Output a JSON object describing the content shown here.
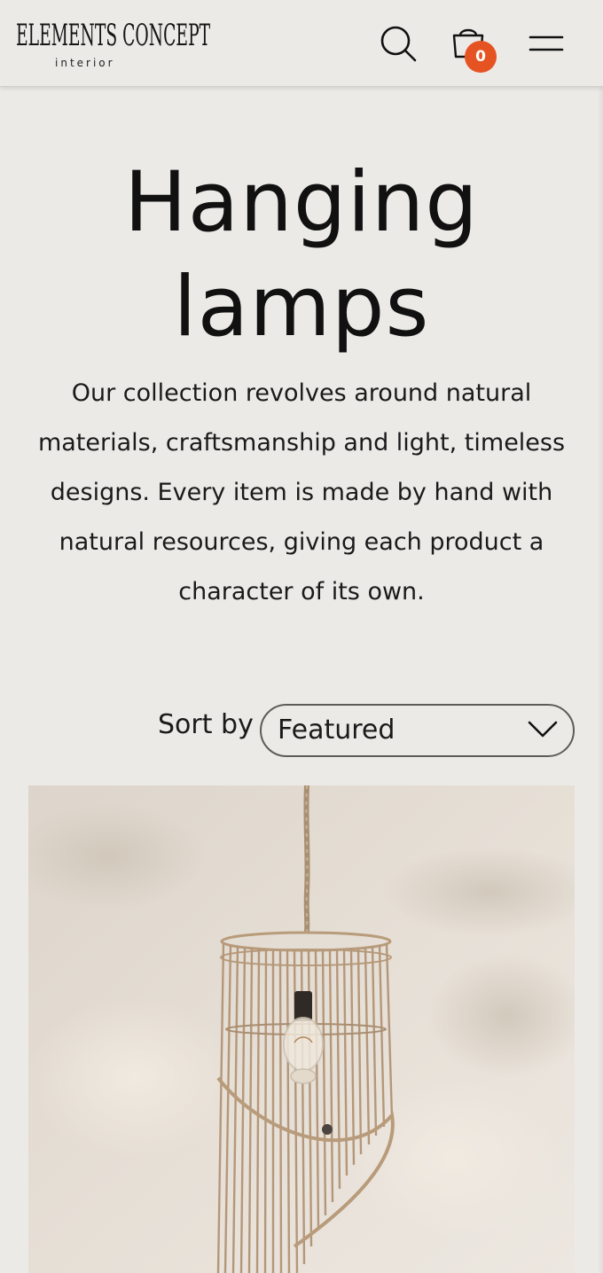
{
  "header": {
    "logo_main": "ELEMENTS CONCEPT",
    "logo_sub": "interior",
    "cart_count": "0",
    "icons": {
      "search": "search-icon",
      "cart": "shopping-bag-icon",
      "menu": "hamburger-menu-icon"
    }
  },
  "main": {
    "title": "Hanging lamps",
    "description": "Our collection revolves around natural materials, craftsmanship and light, timeless designs. Every item is made by hand with natural resources, giving each product a character of its own.",
    "sort": {
      "label": "Sort by",
      "selected": "Featured"
    }
  },
  "colors": {
    "background": "#ebeae7",
    "badge": "#e55322",
    "text": "#111111"
  }
}
